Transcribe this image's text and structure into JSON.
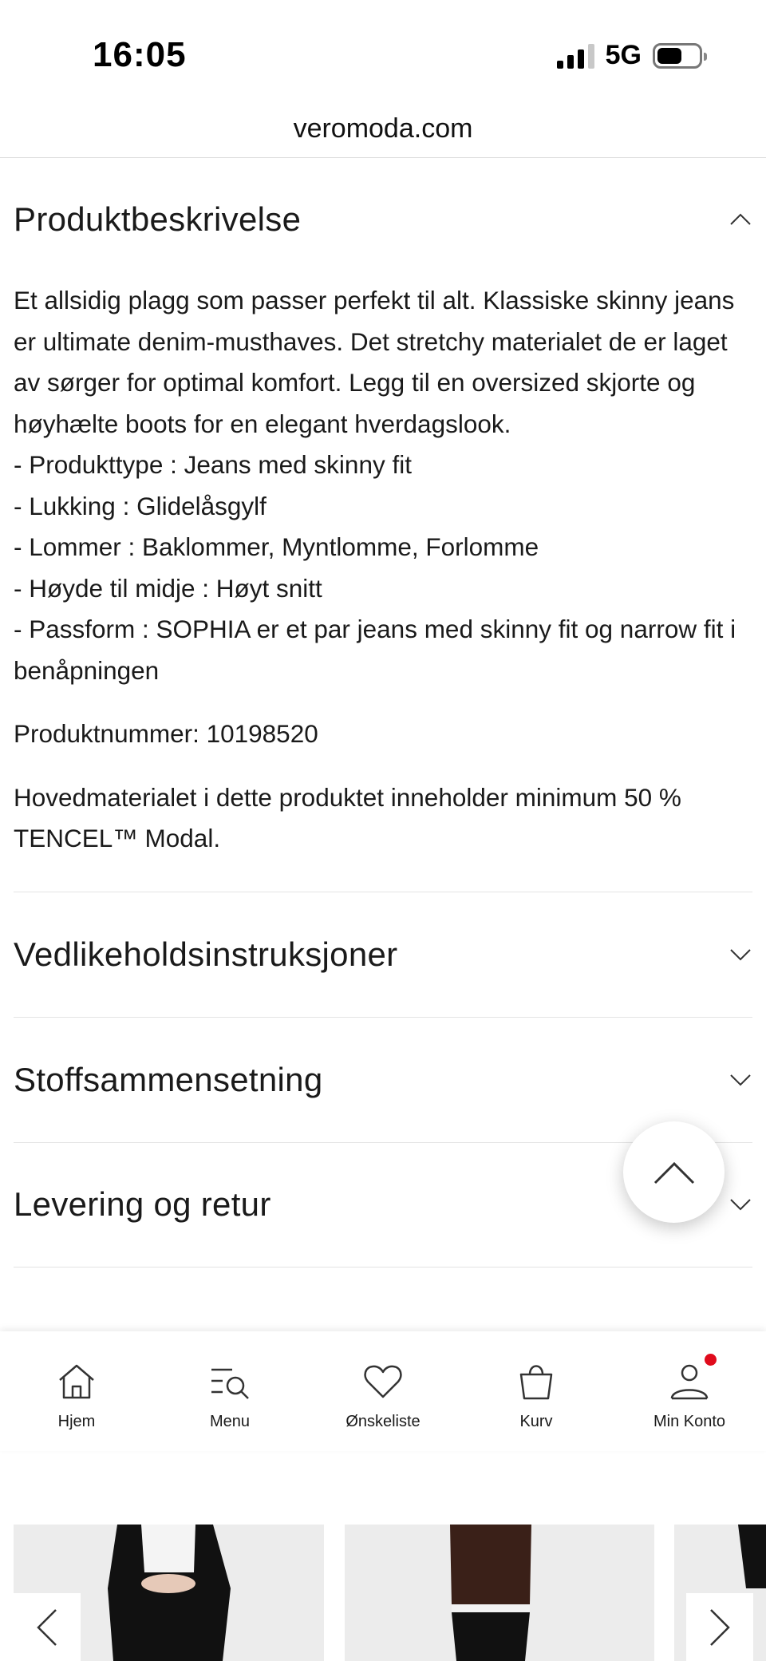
{
  "status": {
    "time": "16:05",
    "network": "5G"
  },
  "browser": {
    "url": "veromoda.com"
  },
  "description": {
    "title": "Produktbeskrivelse",
    "paragraph": "Et allsidig plagg som passer perfekt til alt. Klassiske skinny jeans er ultimate denim-musthaves. Det stretchy materialet de er laget av sørger for optimal komfort. Legg til en oversized skjorte og høyhælte boots for en elegant hverdagslook.",
    "bullets": [
      "- Produkttype : Jeans med skinny fit",
      "- Lukking : Glidelåsgylf",
      "- Lommer : Baklommer, Myntlomme, Forlomme",
      "- Høyde til midje : Høyt snitt",
      "- Passform : SOPHIA er et par jeans med skinny fit og narrow fit i benåpningen"
    ],
    "product_number": "Produktnummer: 10198520",
    "material": "Hovedmaterialet i dette produktet inneholder minimum 50 % TENCEL™ Modal."
  },
  "accordions": [
    {
      "title": "Vedlikeholdsinstruksjoner"
    },
    {
      "title": "Stoffsammensetning"
    },
    {
      "title": "Levering og retur"
    }
  ],
  "nav": [
    {
      "label": "Hjem",
      "icon": "home-icon"
    },
    {
      "label": "Menu",
      "icon": "menu-search-icon"
    },
    {
      "label": "Ønskeliste",
      "icon": "heart-icon"
    },
    {
      "label": "Kurv",
      "icon": "bag-icon"
    },
    {
      "label": "Min Konto",
      "icon": "user-icon"
    }
  ],
  "colors": {
    "accent_dot": "#e00b1c",
    "text": "#1a1a1a"
  }
}
